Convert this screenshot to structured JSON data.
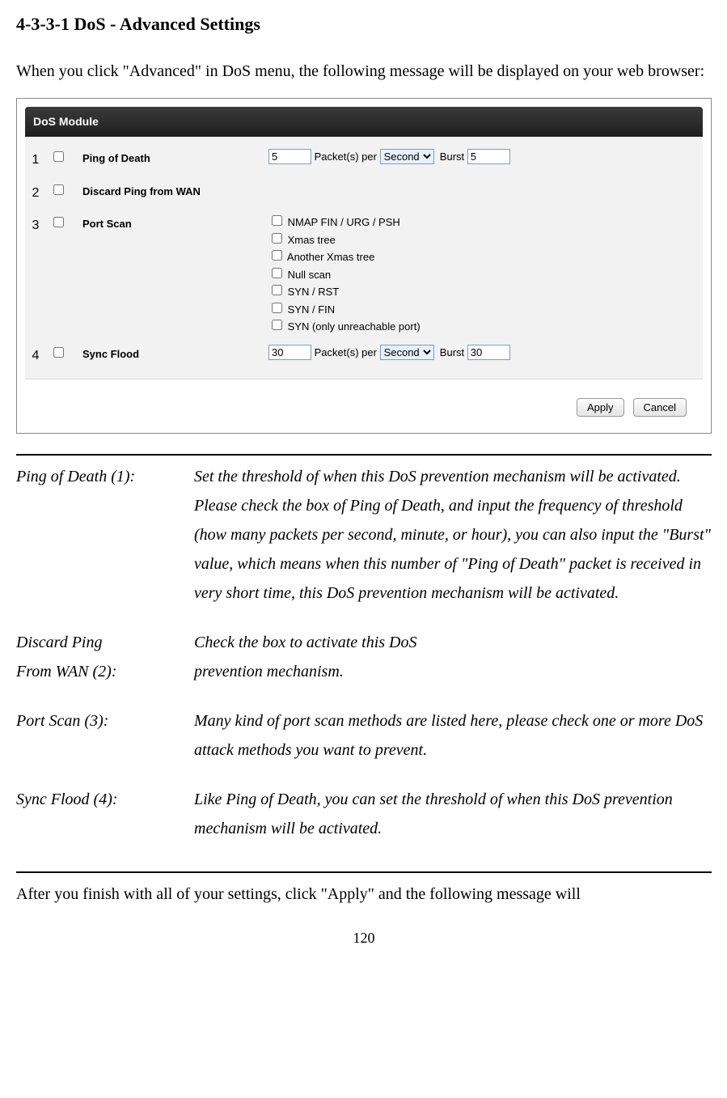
{
  "heading": "4-3-3-1 DoS - Advanced Settings",
  "intro": "When you click \"Advanced\" in DoS menu, the following message will be displayed on your web browser:",
  "module": {
    "title": "DoS Module",
    "rows": {
      "ping_of_death": {
        "annot": "1",
        "label": "Ping of Death",
        "value": "5",
        "packets_per": "Packet(s) per",
        "unit": "Second",
        "burst_label": "Burst",
        "burst_value": "5"
      },
      "discard_ping": {
        "annot": "2",
        "label": "Discard Ping from WAN"
      },
      "port_scan": {
        "annot": "3",
        "label": "Port Scan",
        "options": [
          "NMAP FIN / URG / PSH",
          "Xmas tree",
          "Another Xmas tree",
          "Null scan",
          "SYN / RST",
          "SYN / FIN",
          "SYN (only unreachable port)"
        ]
      },
      "sync_flood": {
        "annot": "4",
        "label": "Sync Flood",
        "value": "30",
        "packets_per": "Packet(s) per",
        "unit": "Second",
        "burst_label": "Burst",
        "burst_value": "30"
      }
    },
    "apply": "Apply",
    "cancel": "Cancel"
  },
  "defs": {
    "d1_term": "Ping of Death (1):",
    "d1_desc": "Set the threshold of when this DoS prevention mechanism will be activated. Please check the box of Ping of Death, and input the frequency of threshold (how many packets per second, minute, or hour), you can also input the \"Burst\" value, which means when this number of \"Ping of Death\" packet is received in very short time, this DoS prevention mechanism will be activated.",
    "d2_term1": "Discard Ping",
    "d2_term2": "From WAN (2):",
    "d2_desc1": "Check the box to activate this DoS",
    "d2_desc2": "prevention mechanism.",
    "d3_term": "Port Scan (3):",
    "d3_desc": "Many kind of port scan methods are listed here, please check one or more DoS attack methods you want to prevent.",
    "d4_term": "Sync Flood (4):",
    "d4_desc": "Like Ping of Death, you can set the threshold of when this DoS prevention mechanism will be activated."
  },
  "outro": "After you finish with all of your settings, click \"Apply\" and the following message will",
  "page_number": "120"
}
